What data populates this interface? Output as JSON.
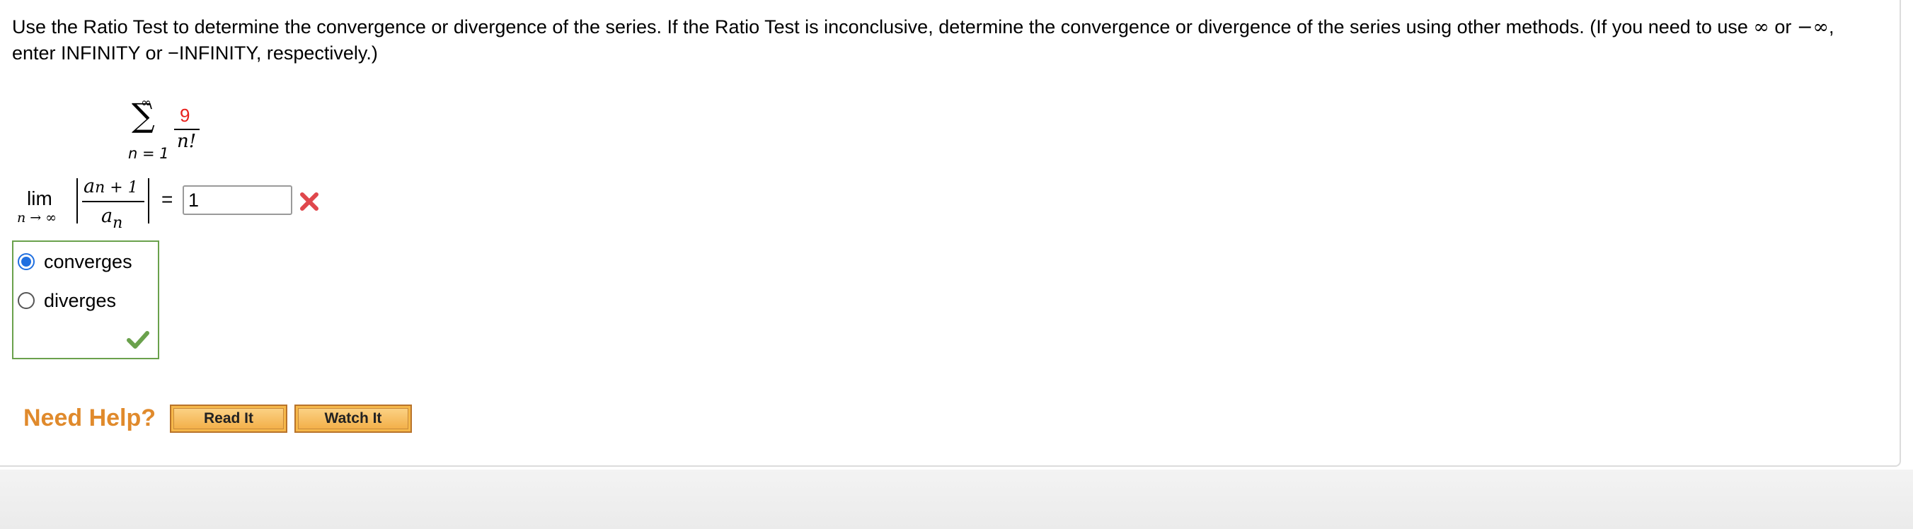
{
  "question": {
    "part1": "Use the Ratio Test to determine the convergence or divergence of the series. If the Ratio Test is inconclusive, determine the convergence or divergence of the series using other methods. (If you need to use ",
    "inf": "∞",
    "or": " or ",
    "neg_inf": "−∞",
    "part2": ", enter INFINITY or −INFINITY, respectively.)"
  },
  "series": {
    "upper": "∞",
    "sigma": "∑",
    "lower": "n = 1",
    "numerator": "9",
    "denominator": "n!"
  },
  "limit": {
    "lim": "lim",
    "lim_sub": "n → ∞",
    "ratio_num_a": "a",
    "ratio_num_sub": "n + 1",
    "ratio_den_a": "a",
    "ratio_den_sub": "n",
    "equals": "=",
    "answer_value": "1",
    "status_icon": "x-mark-icon",
    "status_color": "#e0474c"
  },
  "choice": {
    "options": [
      {
        "label": "converges",
        "selected": true
      },
      {
        "label": "diverges",
        "selected": false
      }
    ],
    "status_icon": "checkmark-icon",
    "status_color": "#6aa14c",
    "border_color": "#6aa14c"
  },
  "help": {
    "title": "Need Help?",
    "read_label": "Read It",
    "watch_label": "Watch It",
    "accent": "#e08a2c"
  }
}
